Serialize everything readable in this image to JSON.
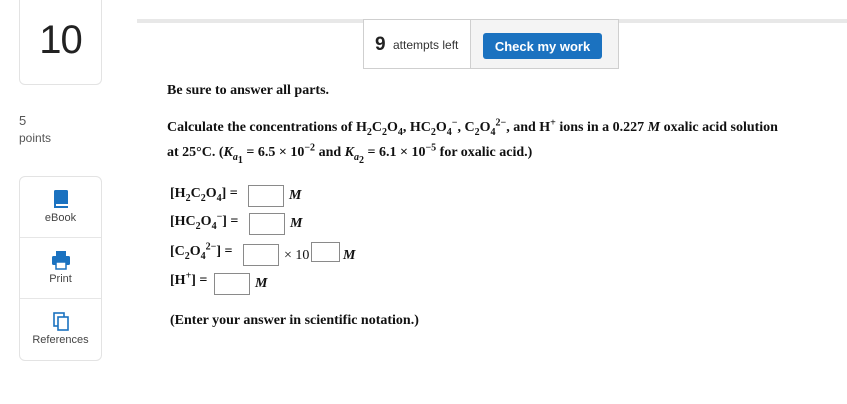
{
  "question": {
    "number": "10",
    "points_value": "5",
    "points_label": "points"
  },
  "sidebar": {
    "items": [
      {
        "label": "eBook",
        "icon": "book-icon"
      },
      {
        "label": "Print",
        "icon": "printer-icon"
      },
      {
        "label": "References",
        "icon": "copy-pages-icon"
      }
    ]
  },
  "attempts": {
    "count": "9",
    "label": "attempts left"
  },
  "check_button": {
    "label": "Check my work"
  },
  "colors": {
    "accent": "#1b72c0",
    "icon_blue": "#1b72c0"
  },
  "content": {
    "instruction": "Be sure to answer all parts.",
    "question_text": {
      "calc": "Calculate the concentrations of ",
      "h2c2o4": {
        "a": "H",
        "s1": "2",
        "b": "C",
        "s2": "2",
        "c": "O",
        "s3": "4"
      },
      "sep1": ", ",
      "hc2o4": {
        "a": "HC",
        "s1": "2",
        "b": "O",
        "s2": "4",
        "charge": "−"
      },
      "sep2": ", ",
      "c2o4": {
        "a": "C",
        "s1": "2",
        "b": "O",
        "s2": "4",
        "charge": "2−"
      },
      "and_h": ", and H",
      "h_charge": "+",
      "ions_in": " ions in a 0.227 ",
      "molar": "M",
      "oxalic": " oxalic acid solution",
      "at": "at 25°C. (",
      "ka": "K",
      "a": "a",
      "one": "1",
      "two": "2",
      "eq1": " = 6.5 × 10",
      "exp1": "−2",
      "and": " and ",
      "eq2": " = 6.1 × 10",
      "exp2": "−5",
      "for": " for oxalic acid.)"
    },
    "answers": [
      {
        "label_parts": [
          "[H",
          "2",
          "C",
          "2",
          "O",
          "4",
          "] ="
        ],
        "value": "",
        "unit": "M"
      },
      {
        "label_parts": [
          "[HC",
          "2",
          "O",
          "4",
          "−",
          "] ="
        ],
        "value": "",
        "unit": "M"
      },
      {
        "label_parts": [
          "[C",
          "2",
          "O",
          "4",
          "2−",
          "] ="
        ],
        "value": "",
        "exponent_value": "",
        "times": "× 10",
        "unit": "M"
      },
      {
        "label_parts": [
          "[H",
          "+",
          "] ="
        ],
        "value": "",
        "unit": "M"
      }
    ],
    "note": "(Enter your answer in scientific notation.)"
  }
}
